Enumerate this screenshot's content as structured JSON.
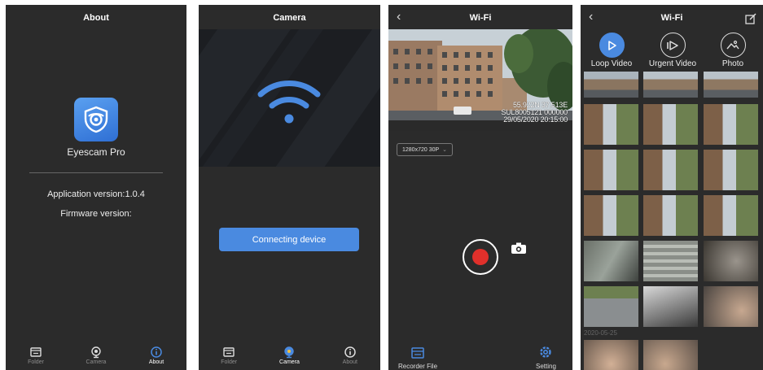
{
  "about_screen": {
    "title": "About",
    "app_name": "Eyescam Pro",
    "app_version": "Application version:1.0.4",
    "firmware_version": "Firmware version:"
  },
  "camera_screen": {
    "title": "Camera",
    "connect_button": "Connecting device"
  },
  "wifi_screen": {
    "title": "Wi-Fi",
    "osd_line1": "55.922N 37.513E",
    "osd_line2": "SUL8005121 000000",
    "osd_line3": "29/05/2020 20:15:00",
    "resolution": "1280x720 30P",
    "recorder_file_label": "Recorder File",
    "setting_label": "Setting"
  },
  "files_screen": {
    "title": "Wi-Fi",
    "modes": [
      {
        "label": "Loop Video",
        "icon": "loop-video-icon"
      },
      {
        "label": "Urgent Video",
        "icon": "urgent-video-icon"
      },
      {
        "label": "Photo",
        "icon": "photo-icon"
      }
    ],
    "date_header": "2020-05-25"
  },
  "tabs": [
    {
      "label": "Folder",
      "icon": "folder-icon"
    },
    {
      "label": "Camera",
      "icon": "camera-icon"
    },
    {
      "label": "About",
      "icon": "info-icon"
    }
  ],
  "colors": {
    "accent": "#4a8ae0",
    "background": "#2b2b2b",
    "record": "#e0302b"
  }
}
